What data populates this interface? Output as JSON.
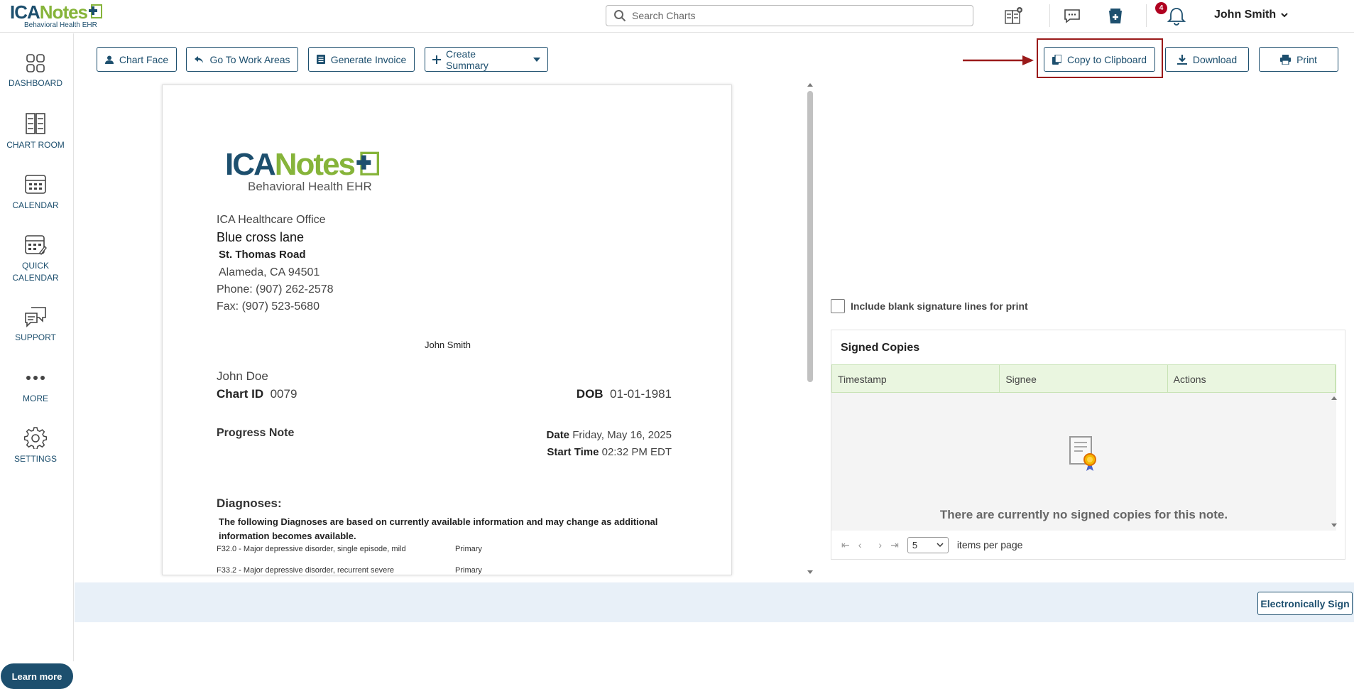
{
  "header": {
    "logo_brand_a": "ICA",
    "logo_brand_b": "Notes",
    "logo_tagline": "Behavioral Health EHR",
    "search_placeholder": "Search Charts",
    "notification_count": "4",
    "user_name": "John Smith"
  },
  "sidebar": {
    "items": [
      {
        "label": "DASHBOARD",
        "icon": "dashboard-icon"
      },
      {
        "label": "CHART ROOM",
        "icon": "chart-room-icon"
      },
      {
        "label": "CALENDAR",
        "icon": "calendar-icon"
      },
      {
        "label": "QUICK CALENDAR",
        "icon": "quick-calendar-icon"
      },
      {
        "label": "SUPPORT",
        "icon": "support-icon"
      },
      {
        "label": "MORE",
        "icon": "more-icon"
      },
      {
        "label": "SETTINGS",
        "icon": "settings-icon"
      }
    ],
    "learn_more": "Learn more"
  },
  "toolbar": {
    "chart_face": "Chart Face",
    "go_to_work_areas": "Go To Work Areas",
    "generate_invoice": "Generate Invoice",
    "create_summary": "Create Summary",
    "copy_to_clipboard": "Copy to Clipboard",
    "download": "Download",
    "print": "Print"
  },
  "document": {
    "office": "ICA Healthcare Office",
    "address1": "Blue cross lane",
    "address2": "St. Thomas Road",
    "city": "Alameda, CA 94501",
    "phone": "Phone: (907) 262-2578",
    "fax": "Fax: (907) 523-5680",
    "provider": "John Smith",
    "patient": "John Doe",
    "chart_id_label": "Chart ID",
    "chart_id": "0079",
    "dob_label": "DOB",
    "dob": "01-01-1981",
    "note_type": "Progress Note",
    "date_label": "Date",
    "date": "Friday, May 16, 2025",
    "start_time_label": "Start Time",
    "start_time": "02:32 PM EDT",
    "diagnoses_title": "Diagnoses:",
    "diagnoses_disclaimer": "The following Diagnoses are based on currently available information and may change as additional information becomes available.",
    "diagnoses": [
      {
        "code": "F32.0 - Major depressive disorder, single episode, mild",
        "rank": "Primary"
      },
      {
        "code": "F33.2 - Major depressive disorder, recurrent severe",
        "rank": "Primary"
      }
    ]
  },
  "signature": {
    "include_blank_label": "Include blank signature lines for print",
    "signed_copies_title": "Signed Copies",
    "columns": [
      "Timestamp",
      "Signee",
      "Actions"
    ],
    "empty_message": "There are currently no signed copies for this note.",
    "page_size": "5",
    "items_per_page": "items per page"
  },
  "footer": {
    "electronically_sign": "Electronically Sign"
  },
  "colors": {
    "brand_navy": "#1d4f6e",
    "brand_green": "#86b43a",
    "highlight_red": "#9a1a1a",
    "badge_red": "#b00020"
  }
}
